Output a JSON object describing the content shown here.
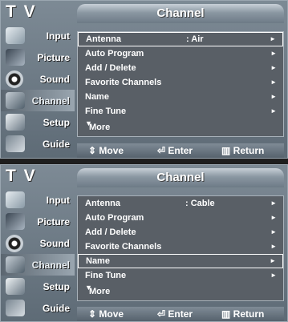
{
  "screens": [
    {
      "brand": "T V",
      "title": "Channel",
      "sidebar": [
        {
          "label": "Input",
          "icon": "input-icon"
        },
        {
          "label": "Picture",
          "icon": "picture-icon"
        },
        {
          "label": "Sound",
          "icon": "sound-icon"
        },
        {
          "label": "Channel",
          "icon": "channel-icon",
          "active": true
        },
        {
          "label": "Setup",
          "icon": "setup-icon"
        },
        {
          "label": "Guide",
          "icon": "guide-icon"
        }
      ],
      "menu": [
        {
          "label": "Antenna",
          "value": ": Air",
          "arrow": "►",
          "selected": true
        },
        {
          "label": "Auto Program",
          "arrow": "►"
        },
        {
          "label": "Add / Delete",
          "arrow": "►"
        },
        {
          "label": "Favorite Channels",
          "arrow": "►"
        },
        {
          "label": "Name",
          "arrow": "►"
        },
        {
          "label": "Fine Tune",
          "arrow": "►"
        }
      ],
      "more": "More",
      "more_icon": "▼",
      "footer": {
        "move": "⇕ Move",
        "enter": "⏎ Enter",
        "return": "▥ Return"
      }
    },
    {
      "brand": "T V",
      "title": "Channel",
      "sidebar": [
        {
          "label": "Input",
          "icon": "input-icon"
        },
        {
          "label": "Picture",
          "icon": "picture-icon"
        },
        {
          "label": "Sound",
          "icon": "sound-icon"
        },
        {
          "label": "Channel",
          "icon": "channel-icon",
          "active": true
        },
        {
          "label": "Setup",
          "icon": "setup-icon"
        },
        {
          "label": "Guide",
          "icon": "guide-icon"
        }
      ],
      "menu": [
        {
          "label": "Antenna",
          "value": ": Cable",
          "arrow": "►"
        },
        {
          "label": "Auto Program",
          "arrow": "►"
        },
        {
          "label": "Add / Delete",
          "arrow": "►"
        },
        {
          "label": "Favorite Channels",
          "arrow": "►"
        },
        {
          "label": "Name",
          "arrow": "►",
          "selected": true
        },
        {
          "label": "Fine Tune",
          "arrow": "►"
        }
      ],
      "more": "More",
      "more_icon": "▼",
      "footer": {
        "move": "⇕ Move",
        "enter": "⏎ Enter",
        "return": "▥ Return"
      }
    }
  ]
}
